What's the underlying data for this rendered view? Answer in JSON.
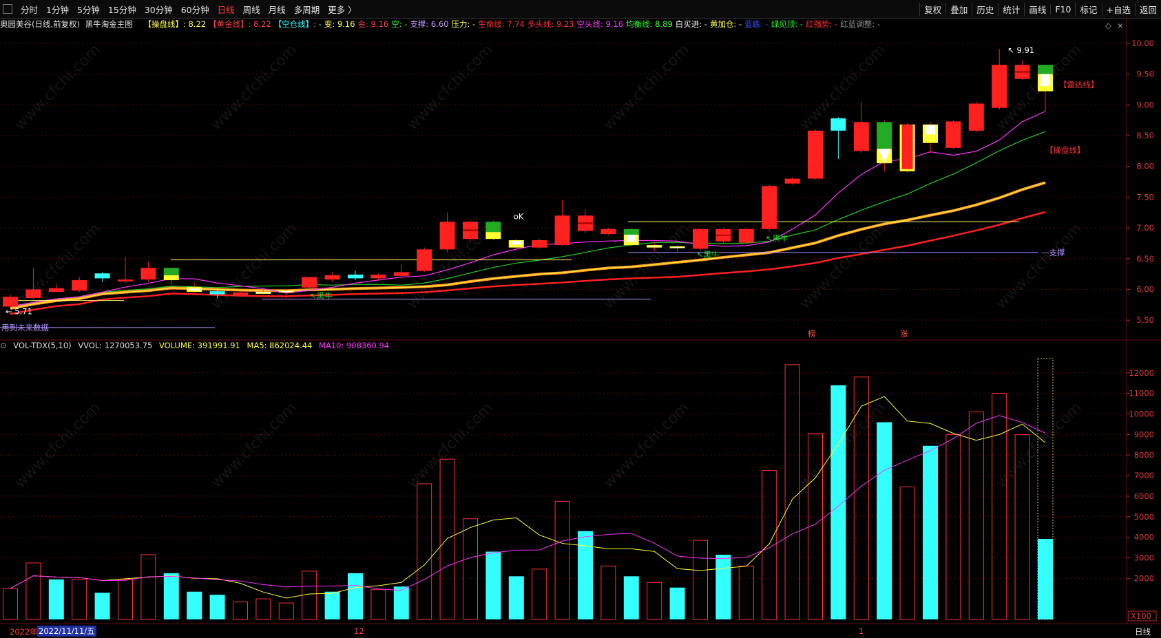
{
  "nav": [
    "分时",
    "1分钟",
    "5分钟",
    "15分钟",
    "30分钟",
    "60分钟",
    "日线",
    "周线",
    "月线",
    "多周期",
    "更多 〉"
  ],
  "nav_active": "日线",
  "tools": [
    "复权",
    "叠加",
    "历史",
    "统计",
    "画线",
    "F10",
    "标记",
    "+自选",
    "返回"
  ],
  "info": {
    "stock": "奥园美谷(日线,前复权)",
    "theme": "黑牛淘金主图",
    "items": [
      {
        "t": "【操盘线】: 8.22",
        "c": "#ffff44"
      },
      {
        "t": "【黄金线】: 8.22",
        "c": "#ff4444"
      },
      {
        "t": "【空仓线】: -",
        "c": "#33ffff"
      },
      {
        "t": "变: 9.16",
        "c": "#ffff44"
      },
      {
        "t": "金: 9.16",
        "c": "#ff4444"
      },
      {
        "t": "空: -",
        "c": "#33ff33"
      },
      {
        "t": "支撑: 6.60",
        "c": "#cc99ff"
      },
      {
        "t": "压力: -",
        "c": "#ffff44"
      },
      {
        "t": "生命线: 7.74",
        "c": "#ff3333"
      },
      {
        "t": "多头线: 9.23",
        "c": "#ff3333"
      },
      {
        "t": "空头线: 9.16",
        "c": "#ff33ff"
      },
      {
        "t": "均衡线: 8.89",
        "c": "#33ff33"
      },
      {
        "t": "白买进: -",
        "c": "#eeeeee"
      },
      {
        "t": "黄加仓: -",
        "c": "#ffff44"
      },
      {
        "t": "蓝跌: -",
        "c": "#3355ff"
      },
      {
        "t": "绿见顶: -",
        "c": "#33ff33"
      },
      {
        "t": "红强势: -",
        "c": "#ff3333"
      },
      {
        "t": "红蓝调整: -",
        "c": "#999999"
      }
    ]
  },
  "vol_info": {
    "name": "VOL-TDX(5,10)",
    "vvol": "VVOL: 1270053.75",
    "volume": "VOLUME: 391991.91",
    "ma5": "MA5: 862024.44",
    "ma10": "MA10: 908360.94"
  },
  "price_axis": [
    "10.00",
    "9.50",
    "9.00",
    "8.50",
    "8.00",
    "7.50",
    "7.00",
    "6.50",
    "6.00",
    "5.50"
  ],
  "vol_axis": [
    "12000",
    "11000",
    "10000",
    "9000",
    "8000",
    "7000",
    "6000",
    "5000",
    "4000",
    "3000",
    "2000"
  ],
  "vol_unit": "X100",
  "annotations": {
    "high": "9.91",
    "low": "5.71",
    "ok": "oK",
    "radar": "【雷达线】",
    "trade_line": "【操盘线】",
    "support": "支撑",
    "black_bull_1": "黑牛",
    "black_bull_2": "黑牛",
    "black_bull_3": "黑牛",
    "future_note": "用到未来数据",
    "mark_bang": "榜",
    "mark_zhang": "涨"
  },
  "bottom": {
    "year": "2022年",
    "date": "2022/11/11/五",
    "m12": "12",
    "m1": "1",
    "period": "日线"
  },
  "watermark": "www.cfchi.com",
  "colors": {
    "up": "#ff2020",
    "down": "#33ffff",
    "yellow": "#ffff33",
    "green": "#22cc22",
    "magenta": "#ff33ff",
    "orange": "#ff9922",
    "support": "#b090ff"
  },
  "chart_data": {
    "type": "candlestick",
    "price_ylim": [
      5.2,
      10.2
    ],
    "candles": [
      {
        "o": 5.88,
        "c": 5.72,
        "h": 5.92,
        "l": 5.71,
        "k": "up"
      },
      {
        "o": 6.0,
        "c": 5.86,
        "h": 6.35,
        "l": 5.84,
        "k": "up"
      },
      {
        "o": 6.02,
        "c": 5.96,
        "h": 6.08,
        "l": 5.95,
        "k": "up"
      },
      {
        "o": 6.15,
        "c": 5.98,
        "h": 6.2,
        "l": 5.96,
        "k": "up"
      },
      {
        "o": 6.18,
        "c": 6.26,
        "h": 6.28,
        "l": 6.12,
        "k": "cyan"
      },
      {
        "o": 6.16,
        "c": 6.13,
        "h": 6.52,
        "l": 6.1,
        "k": "up"
      },
      {
        "o": 6.35,
        "c": 6.16,
        "h": 6.45,
        "l": 6.12,
        "k": "up"
      },
      {
        "o": 6.15,
        "c": 6.35,
        "h": 6.35,
        "l": 6.07,
        "k": "gy"
      },
      {
        "o": 6.04,
        "c": 5.96,
        "h": 6.1,
        "l": 5.95,
        "k": "yl"
      },
      {
        "o": 5.97,
        "c": 5.92,
        "h": 6.03,
        "l": 5.85,
        "k": "cyan"
      },
      {
        "o": 5.95,
        "c": 5.9,
        "h": 5.97,
        "l": 5.88,
        "k": "up"
      },
      {
        "o": 5.96,
        "c": 5.93,
        "h": 5.98,
        "l": 5.92,
        "k": "wy"
      },
      {
        "o": 5.95,
        "c": 5.98,
        "h": 6.0,
        "l": 5.86,
        "k": "yl"
      },
      {
        "o": 6.03,
        "c": 6.2,
        "h": 6.2,
        "l": 6.0,
        "k": "up"
      },
      {
        "o": 6.23,
        "c": 6.16,
        "h": 6.28,
        "l": 6.12,
        "k": "up"
      },
      {
        "o": 6.18,
        "c": 6.24,
        "h": 6.3,
        "l": 6.15,
        "k": "cyan"
      },
      {
        "o": 6.24,
        "c": 6.18,
        "h": 6.26,
        "l": 6.15,
        "k": "up"
      },
      {
        "o": 6.28,
        "c": 6.22,
        "h": 6.4,
        "l": 6.2,
        "k": "up"
      },
      {
        "o": 6.65,
        "c": 6.3,
        "h": 6.68,
        "l": 6.28,
        "k": "up"
      },
      {
        "o": 7.1,
        "c": 6.65,
        "h": 7.25,
        "l": 6.6,
        "k": "up"
      },
      {
        "o": 7.1,
        "c": 6.82,
        "h": 7.12,
        "l": 6.78,
        "k": "upb"
      },
      {
        "o": 7.1,
        "c": 6.82,
        "h": 7.12,
        "l": 6.8,
        "k": "gy"
      },
      {
        "o": 6.8,
        "c": 6.68,
        "h": 6.82,
        "l": 6.65,
        "k": "yw"
      },
      {
        "o": 6.8,
        "c": 6.68,
        "h": 6.82,
        "l": 6.66,
        "k": "up"
      },
      {
        "o": 7.2,
        "c": 6.72,
        "h": 7.45,
        "l": 6.7,
        "k": "up"
      },
      {
        "o": 7.2,
        "c": 6.95,
        "h": 7.3,
        "l": 6.92,
        "k": "upb"
      },
      {
        "o": 6.98,
        "c": 6.9,
        "h": 7.0,
        "l": 6.88,
        "k": "up"
      },
      {
        "o": 6.98,
        "c": 6.72,
        "h": 7.0,
        "l": 6.7,
        "k": "gyy"
      },
      {
        "o": 6.72,
        "c": 6.68,
        "h": 6.78,
        "l": 6.62,
        "k": "yl"
      },
      {
        "o": 6.7,
        "c": 6.67,
        "h": 6.72,
        "l": 6.6,
        "k": "yw"
      },
      {
        "o": 6.98,
        "c": 6.66,
        "h": 7.0,
        "l": 6.63,
        "k": "up"
      },
      {
        "o": 6.98,
        "c": 6.78,
        "h": 7.0,
        "l": 6.75,
        "k": "upb"
      },
      {
        "o": 6.98,
        "c": 6.76,
        "h": 7.0,
        "l": 6.74,
        "k": "up"
      },
      {
        "o": 7.68,
        "c": 6.98,
        "h": 7.7,
        "l": 6.95,
        "k": "up"
      },
      {
        "o": 7.8,
        "c": 7.72,
        "h": 7.82,
        "l": 7.7,
        "k": "up"
      },
      {
        "o": 8.58,
        "c": 7.8,
        "h": 8.6,
        "l": 7.78,
        "k": "up"
      },
      {
        "o": 8.78,
        "c": 8.58,
        "h": 8.8,
        "l": 8.12,
        "k": "cyan"
      },
      {
        "o": 8.72,
        "c": 8.25,
        "h": 9.05,
        "l": 8.22,
        "k": "up"
      },
      {
        "o": 8.72,
        "c": 8.05,
        "h": 8.75,
        "l": 7.92,
        "k": "gyw"
      },
      {
        "o": 8.68,
        "c": 7.92,
        "h": 8.7,
        "l": 7.9,
        "k": "yr"
      },
      {
        "o": 8.68,
        "c": 8.38,
        "h": 8.72,
        "l": 8.22,
        "k": "yw"
      },
      {
        "o": 8.73,
        "c": 8.3,
        "h": 8.75,
        "l": 8.28,
        "k": "up"
      },
      {
        "o": 9.02,
        "c": 8.58,
        "h": 9.05,
        "l": 8.55,
        "k": "up"
      },
      {
        "o": 9.65,
        "c": 8.95,
        "h": 9.91,
        "l": 8.92,
        "k": "up"
      },
      {
        "o": 9.65,
        "c": 9.42,
        "h": 9.72,
        "l": 9.4,
        "k": "upb"
      },
      {
        "o": 9.65,
        "c": 9.22,
        "h": 9.65,
        "l": 8.9,
        "k": "gyy"
      }
    ],
    "vol_ylim": [
      0,
      13000
    ],
    "volumes": [
      1500,
      2750,
      1950,
      1950,
      1300,
      1950,
      3150,
      2250,
      1350,
      1200,
      850,
      1000,
      800,
      2350,
      1350,
      2250,
      1450,
      1600,
      6600,
      7800,
      4900,
      3300,
      2100,
      2450,
      5750,
      4300,
      2600,
      2100,
      1800,
      1550,
      3850,
      3150,
      2600,
      7250,
      12400,
      9050,
      11400,
      11800,
      9600,
      6450,
      8450,
      9000,
      10100,
      11000,
      9000,
      3920
    ],
    "vol_kinds": [
      "r",
      "r",
      "c",
      "r",
      "c",
      "r",
      "r",
      "c",
      "c",
      "c",
      "r",
      "r",
      "r",
      "r",
      "c",
      "c",
      "r",
      "c",
      "r",
      "r",
      "r",
      "c",
      "c",
      "r",
      "r",
      "c",
      "r",
      "c",
      "r",
      "c",
      "r",
      "c",
      "r",
      "r",
      "r",
      "r",
      "c",
      "r",
      "c",
      "r",
      "c",
      "r",
      "r",
      "r",
      "r",
      "c"
    ]
  }
}
